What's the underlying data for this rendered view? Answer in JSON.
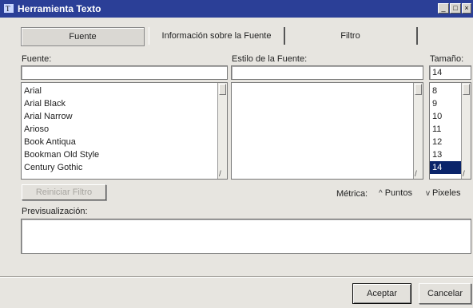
{
  "window": {
    "title": "Herramienta Texto",
    "minimize_glyph": "_",
    "maximize_glyph": "□",
    "close_glyph": "×"
  },
  "tabs": [
    {
      "label": "Fuente",
      "selected": true
    },
    {
      "label": "Información sobre la Fuente",
      "selected": false
    },
    {
      "label": "Filtro",
      "selected": false
    }
  ],
  "font": {
    "label": "Fuente:",
    "value": "",
    "items": [
      "Arial",
      "Arial Black",
      "Arial Narrow",
      "Arioso",
      "Book Antiqua",
      "Bookman Old Style",
      "Century Gothic"
    ]
  },
  "style": {
    "label": "Estilo de la Fuente:",
    "value": "",
    "items": []
  },
  "size": {
    "label": "Tamaño:",
    "value": "14",
    "items": [
      "8",
      "9",
      "10",
      "11",
      "12",
      "13",
      "14"
    ],
    "selected": "14"
  },
  "reset_filter_label": "Reiniciar Filtro",
  "metrics": {
    "label": "Métrica:",
    "options": [
      "Puntos",
      "Pixeles"
    ],
    "selected": "Pixeles"
  },
  "preview": {
    "label": "Previsualización:",
    "text": ""
  },
  "buttons": {
    "accept": "Aceptar",
    "cancel": "Cancelar"
  },
  "colors": {
    "titlebar": "#2b3f97",
    "selection": "#0a246a",
    "dialog_bg": "#e7e5e0"
  },
  "icons": {
    "window": "text-tool-icon"
  }
}
